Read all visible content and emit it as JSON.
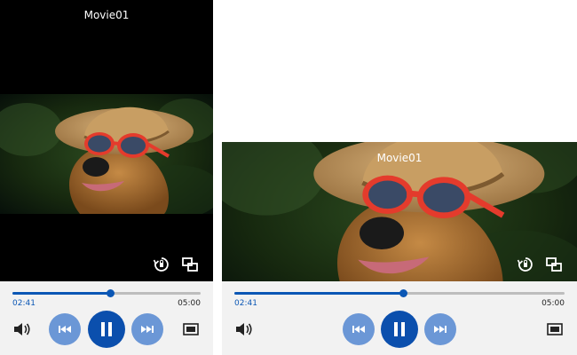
{
  "colors": {
    "accent": "#0b57b5",
    "button_light": "#6b97d6",
    "button_dark": "#0b4fad",
    "control_bg": "#f2f2f2"
  },
  "players": [
    {
      "orientation": "portrait",
      "title": "Movie01",
      "current_time": "02:41",
      "duration": "05:00",
      "progress": 0.52
    },
    {
      "orientation": "landscape",
      "title": "Movie01",
      "current_time": "02:41",
      "duration": "05:00",
      "progress": 0.51
    }
  ],
  "icons": {
    "rotate": "rotate-lock-icon",
    "popup": "popup-window-icon",
    "volume": "volume-icon",
    "previous": "skip-previous-icon",
    "pause": "pause-icon",
    "next": "skip-next-icon",
    "aspect": "aspect-ratio-icon"
  }
}
